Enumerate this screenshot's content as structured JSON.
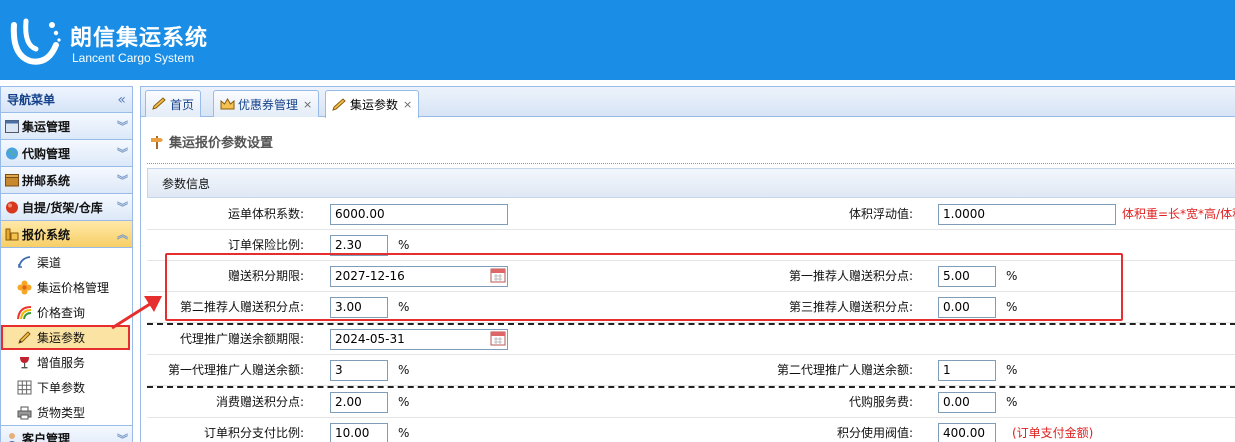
{
  "brand": {
    "title": "朗信集运系统",
    "subtitle": "Lancent Cargo System"
  },
  "sidebar": {
    "header": "导航菜单",
    "collapse_glyph": "«",
    "groups": [
      {
        "label": "集运管理"
      },
      {
        "label": "代购管理"
      },
      {
        "label": "拼邮系统"
      },
      {
        "label": "自提/货架/仓库"
      },
      {
        "label": "报价系统",
        "active": true
      },
      {
        "label": "客户管理"
      }
    ],
    "items": [
      {
        "label": "渠道"
      },
      {
        "label": "集运价格管理"
      },
      {
        "label": "价格查询"
      },
      {
        "label": "集运参数",
        "selected": true
      },
      {
        "label": "增值服务"
      },
      {
        "label": "下单参数"
      },
      {
        "label": "货物类型"
      }
    ]
  },
  "tabs": [
    {
      "label": "首页",
      "closable": false
    },
    {
      "label": "优惠券管理",
      "closable": true
    },
    {
      "label": "集运参数",
      "closable": true,
      "active": true
    }
  ],
  "tab_close_glyph": "×",
  "section_title": "集运报价参数设置",
  "params_header": "参数信息",
  "form": {
    "volume_coef_label": "运单体积系数:",
    "volume_coef_value": "6000.00",
    "volume_float_label": "体积浮动值:",
    "volume_float_value": "1.0000",
    "volume_hint": "体积重=长*宽*高/体积",
    "insurance_label": "订单保险比例:",
    "insurance_value": "2.30",
    "points_expiry_label": "赠送积分期限:",
    "points_expiry_value": "2027-12-16",
    "ref1_label": "第一推荐人赠送积分点:",
    "ref1_value": "5.00",
    "ref2_label": "第二推荐人赠送积分点:",
    "ref2_value": "3.00",
    "ref3_label": "第三推荐人赠送积分点:",
    "ref3_value": "0.00",
    "agent_expiry_label": "代理推广赠送余额期限:",
    "agent_expiry_value": "2024-05-31",
    "agent1_label": "第一代理推广人赠送余额:",
    "agent1_value": "3",
    "agent2_label": "第二代理推广人赠送余额:",
    "agent2_value": "1",
    "consume_points_label": "消费赠送积分点:",
    "consume_points_value": "2.00",
    "purchase_fee_label": "代购服务费:",
    "purchase_fee_value": "0.00",
    "points_pay_label": "订单积分支付比例:",
    "points_pay_value": "10.00",
    "points_threshold_label": "积分使用阀值:",
    "points_threshold_value": "400.00",
    "points_threshold_hint": "(订单支付金额)",
    "percent": "%"
  },
  "colors": {
    "header_bg": "#1a8ee6",
    "accent_red": "#e62e2e",
    "hint_red": "#e02020",
    "panel_border": "#99bbe8"
  }
}
